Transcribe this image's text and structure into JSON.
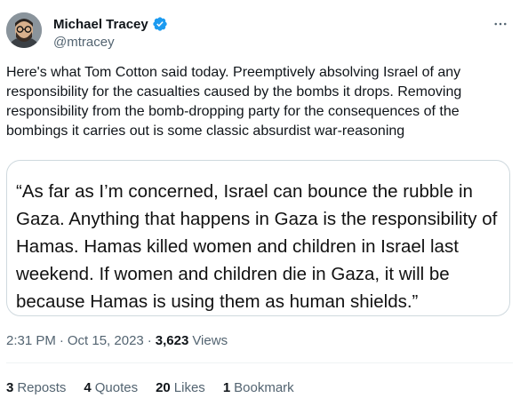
{
  "author": {
    "name": "Michael Tracey",
    "handle": "@mtracey"
  },
  "tweet": {
    "text": "Here's what Tom Cotton said today. Preemptively absolving Israel of any responsibility for the casualties caused by the bombs it drops. Removing responsibility from the bomb-dropping party for the consequences of the bombings it carries out is some classic absurdist war-reasoning",
    "quote": "“As far as I’m concerned, Israel can bounce the rubble in Gaza. Anything that happens in Gaza is the responsibility of Hamas. Hamas killed women and children in Israel last weekend. If women and children die in Gaza, it will be because Hamas is using them as human shields.”"
  },
  "meta": {
    "time": "2:31 PM",
    "separator": "·",
    "date": "Oct 15, 2023",
    "views_count": "3,623",
    "views_label": "Views"
  },
  "stats": [
    {
      "count": "3",
      "label": "Reposts"
    },
    {
      "count": "4",
      "label": "Quotes"
    },
    {
      "count": "20",
      "label": "Likes"
    },
    {
      "count": "1",
      "label": "Bookmark"
    }
  ],
  "colors": {
    "verified": "#1d9bf0",
    "secondary_text": "#536471",
    "border": "#cfd9de"
  },
  "icons": {
    "verified": "verified-badge-icon",
    "more": "more-options-icon"
  }
}
